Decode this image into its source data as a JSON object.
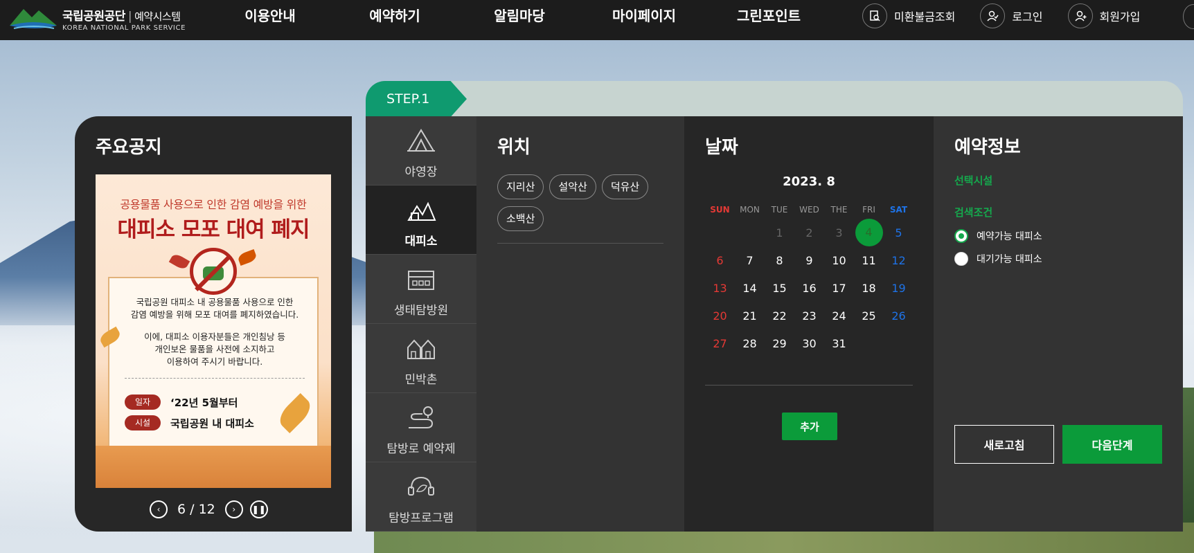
{
  "header": {
    "logo_title": "국립공원공단",
    "logo_system": "예약시스템",
    "logo_sub": "KOREA NATIONAL PARK SERVICE",
    "nav": [
      "이용안내",
      "예약하기",
      "알림마당",
      "마이페이지",
      "그린포인트"
    ],
    "util": {
      "unpaid": "미환불금조회",
      "login": "로그인",
      "signup": "회원가입"
    }
  },
  "notice": {
    "title": "주요공지",
    "banner": {
      "top": "공용물품 사용으로 인한 감염 예방을 위한",
      "headline": "대피소 모포 대여 폐지",
      "body1_line1": "국립공원 대피소 내 공용물품 사용으로 인한",
      "body1_line2": "감염 예방을 위해 모포 대여를 폐지하였습니다.",
      "body2_line1": "이에, 대피소 이용자분들은 개인침낭 등",
      "body2_line2": "개인보온 물품을 사전에 소지하고",
      "body2_line3": "이용하여 주시기 바랍니다.",
      "date_tag": "일자",
      "date_value": "‘22년 5월부터",
      "place_tag": "시설",
      "place_value": "국립공원 내 대피소"
    },
    "pager": {
      "current": "6",
      "sep": "/",
      "total": "12"
    }
  },
  "step": {
    "label": "STEP.1",
    "categories": [
      "야영장",
      "대피소",
      "생태탐방원",
      "민박촌",
      "탐방로 예약제",
      "탐방프로그램"
    ],
    "active_category": "대피소"
  },
  "location": {
    "title": "위치",
    "chips": [
      "지리산",
      "설악산",
      "덕유산",
      "소백산"
    ]
  },
  "date": {
    "title": "날짜",
    "month": "2023. 8",
    "weekdays": [
      "SUN",
      "MON",
      "TUE",
      "WED",
      "THE",
      "FRI",
      "SAT"
    ],
    "weeks": [
      [
        "",
        "",
        "1",
        "2",
        "3",
        "4",
        "5"
      ],
      [
        "6",
        "7",
        "8",
        "9",
        "10",
        "11",
        "12"
      ],
      [
        "13",
        "14",
        "15",
        "16",
        "17",
        "18",
        "19"
      ],
      [
        "20",
        "21",
        "22",
        "23",
        "24",
        "25",
        "26"
      ],
      [
        "27",
        "28",
        "29",
        "30",
        "31",
        "",
        ""
      ]
    ],
    "today": "4",
    "add_label": "추가"
  },
  "info": {
    "title": "예약정보",
    "selected_label": "선택시설",
    "search_label": "검색조건",
    "option_available": "예약가능 대피소",
    "option_waiting": "대기가능 대피소",
    "refresh_label": "새로고침",
    "next_label": "다음단계"
  },
  "colors": {
    "accent_green": "#0b9b3a",
    "step_teal": "#0f9a6f",
    "sunday_red": "#e53935",
    "saturday_blue": "#1e73e8"
  }
}
